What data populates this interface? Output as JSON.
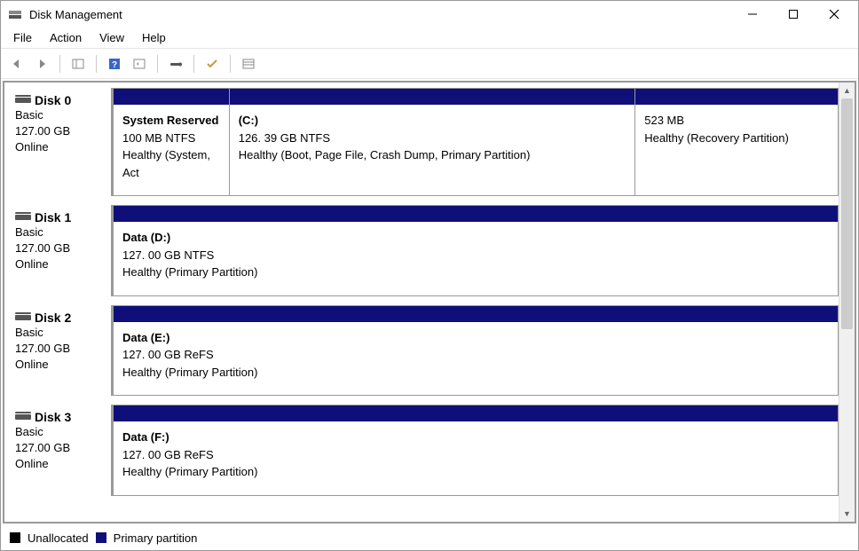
{
  "title": "Disk Management",
  "menu": {
    "file": "File",
    "action": "Action",
    "view": "View",
    "help": "Help"
  },
  "legend": {
    "unallocated": "Unallocated",
    "primary": "Primary partition"
  },
  "disks": [
    {
      "name": "Disk 0",
      "type": "Basic",
      "size": "127.00 GB",
      "status": "Online",
      "volumes": [
        {
          "name": "System Reserved",
          "size": "100 MB NTFS",
          "status": "Healthy (System, Act",
          "widthPct": 16
        },
        {
          "name": "(C:)",
          "size": "126. 39 GB NTFS",
          "status": "Healthy (Boot, Page File, Crash Dump, Primary Partition)",
          "widthPct": 56
        },
        {
          "name": "",
          "size": "523 MB",
          "status": "Healthy (Recovery Partition)",
          "widthPct": 28
        }
      ]
    },
    {
      "name": "Disk 1",
      "type": "Basic",
      "size": "127.00 GB",
      "status": "Online",
      "volumes": [
        {
          "name": "Data (D:)",
          "size": "127. 00 GB NTFS",
          "status": "Healthy (Primary Partition)",
          "widthPct": 100
        }
      ]
    },
    {
      "name": "Disk 2",
      "type": "Basic",
      "size": "127.00 GB",
      "status": "Online",
      "volumes": [
        {
          "name": "Data (E:)",
          "size": "127. 00 GB ReFS",
          "status": "Healthy (Primary Partition)",
          "widthPct": 100
        }
      ]
    },
    {
      "name": "Disk 3",
      "type": "Basic",
      "size": "127.00 GB",
      "status": "Online",
      "volumes": [
        {
          "name": "Data (F:)",
          "size": "127. 00 GB ReFS",
          "status": "Healthy (Primary Partition)",
          "widthPct": 100
        }
      ]
    }
  ]
}
